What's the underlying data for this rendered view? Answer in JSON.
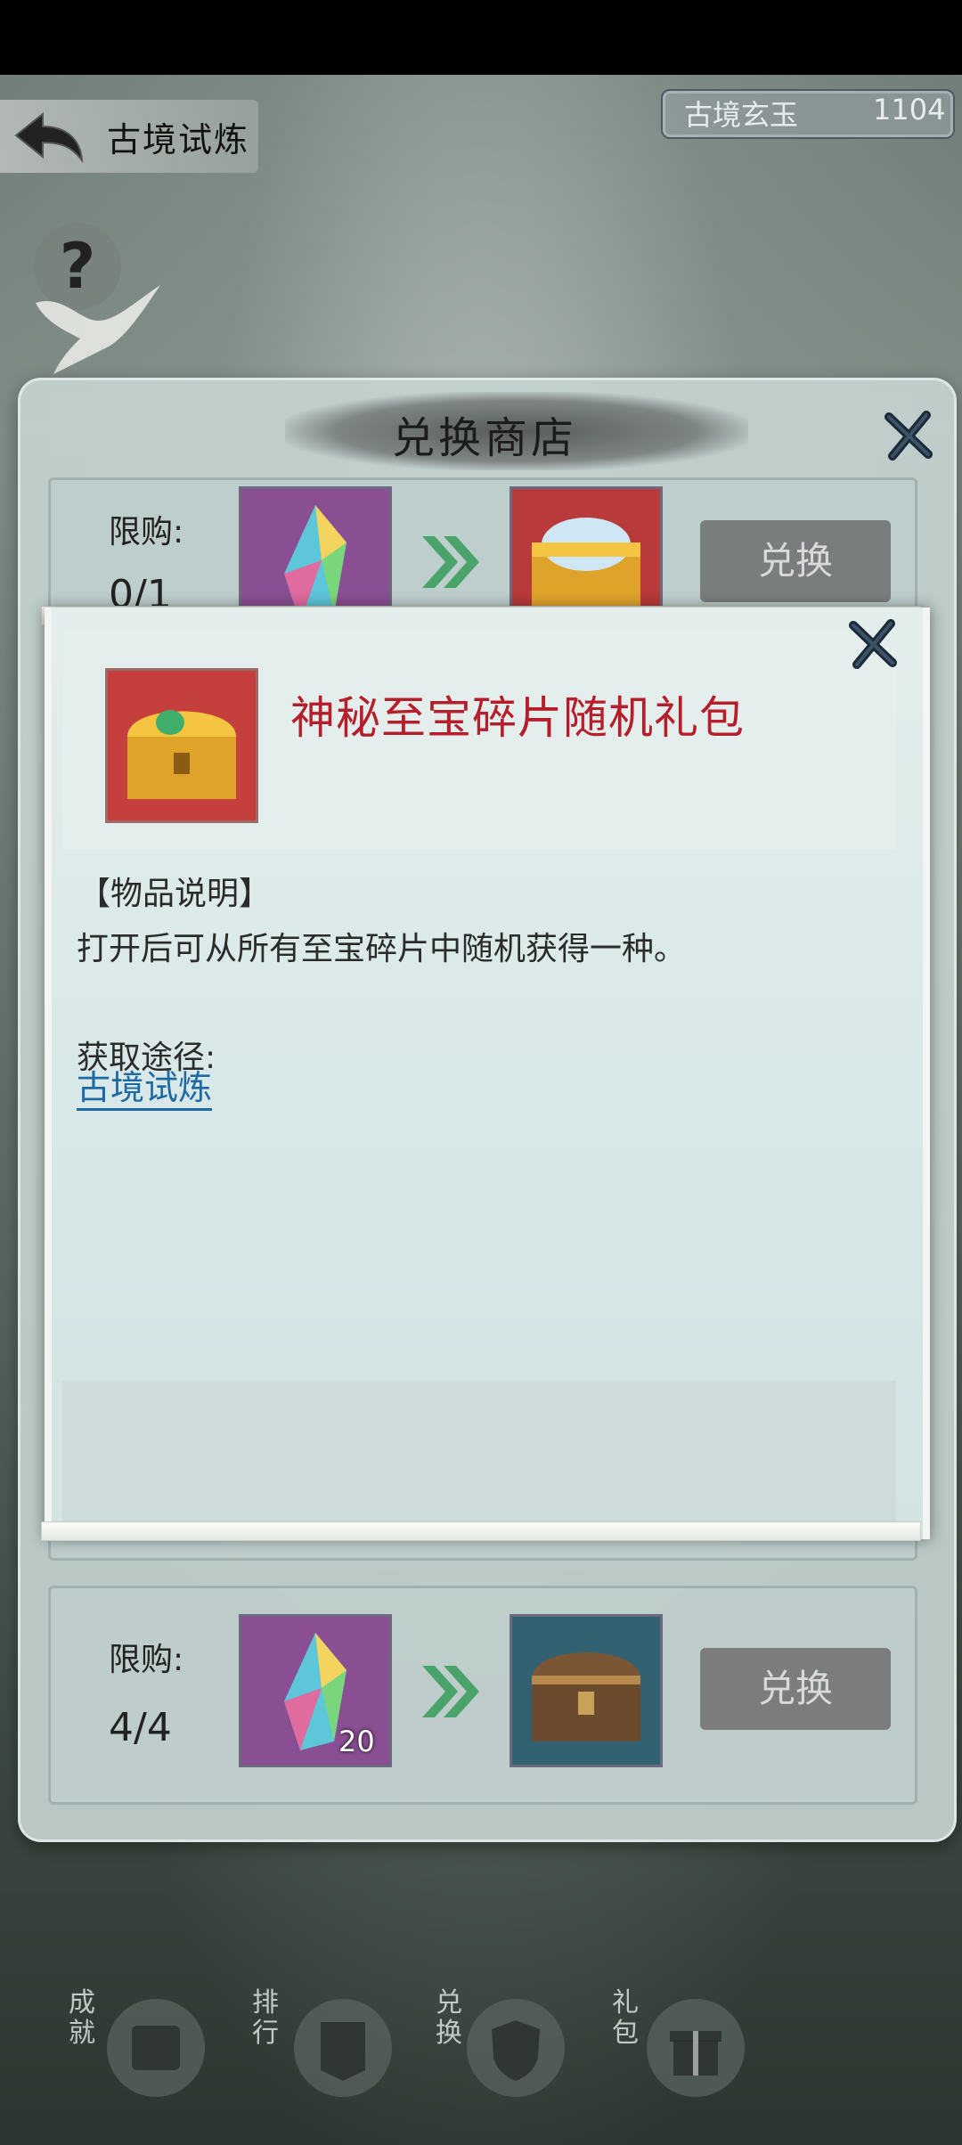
{
  "header": {
    "title": "古境试炼",
    "currency_name": "古境玄玉",
    "currency_value": "1104",
    "help_symbol": "?"
  },
  "shop": {
    "title": "兑换商店",
    "rows": [
      {
        "limit_label": "限购:",
        "limit_value": "0/1",
        "cost_item": "rainbow-crystal-icon",
        "reward_item": "mystic-treasure-chest-icon",
        "button_label": "兑换"
      },
      {
        "limit_label": "限购:",
        "limit_value": "4/4",
        "cost_item": "rainbow-crystal-icon",
        "cost_qty": "20",
        "reward_item": "wooden-chest-icon",
        "button_label": "兑换"
      }
    ]
  },
  "popup": {
    "item_name": "神秘至宝碎片随机礼包",
    "desc_title": "【物品说明】",
    "desc_text": "打开后可从所有至宝碎片中随机获得一种。",
    "source_label": "获取途径:",
    "source_link": "古境试炼"
  },
  "bottom_nav": [
    {
      "label": "成就",
      "icon": "scroll-icon"
    },
    {
      "label": "排行",
      "icon": "banner-icon"
    },
    {
      "label": "兑换",
      "icon": "shield-icon"
    },
    {
      "label": "礼包",
      "icon": "gift-icon"
    }
  ],
  "colors": {
    "item_name": "#b51e2a",
    "link": "#1f6aa5"
  }
}
